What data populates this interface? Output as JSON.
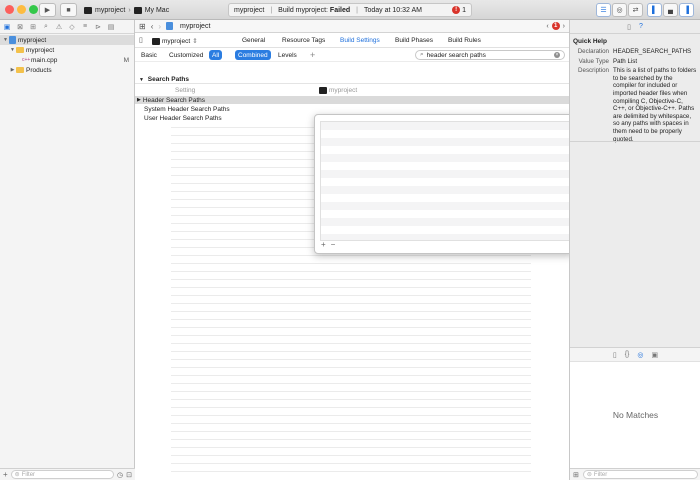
{
  "toolbar": {
    "scheme_project": "myproject",
    "scheme_destination": "My Mac",
    "status_project": "myproject",
    "status_sep": "|",
    "status_build_prefix": "Build myproject:",
    "status_build_result": "Failed",
    "status_sep2": "|",
    "status_time": "Today at 10:32 AM",
    "error_count": "1",
    "colors": {
      "close": "#fc605c",
      "minimize": "#fdbc40",
      "zoom": "#34c84a",
      "accent": "#1d6fdc",
      "error": "#d9342b"
    }
  },
  "navigator": {
    "tree": [
      {
        "label": "myproject",
        "icon": "project-icon"
      },
      {
        "label": "myproject",
        "icon": "folder-icon"
      },
      {
        "label": "main.cpp",
        "icon": "cpp-file-icon",
        "badge": "M"
      },
      {
        "label": "Products",
        "icon": "folder-icon"
      }
    ],
    "filter_placeholder": "Filter"
  },
  "editor": {
    "jump_project": "myproject",
    "error_count": "1",
    "target": "myproject",
    "tabs": [
      "General",
      "Resource Tags",
      "Build Settings",
      "Build Phases",
      "Build Rules"
    ],
    "filters": [
      "Basic",
      "Customized",
      "All",
      "Combined",
      "Levels"
    ],
    "add_label": "+",
    "search_value": "header search paths",
    "section_title": "Search Paths",
    "col_setting": "Setting",
    "col_target": "myproject",
    "settings": [
      "Header Search Paths",
      "System Header Search Paths",
      "User Header Search Paths"
    ],
    "popover_add": "+",
    "popover_remove": "−"
  },
  "inspector": {
    "title": "Quick Help",
    "declaration_label": "Declaration",
    "declaration_value": "HEADER_SEARCH_PATHS",
    "value_type_label": "Value Type",
    "value_type_value": "Path List",
    "description_label": "Description",
    "description_value": "This is a list of paths to folders to be searched by the compiler for included or imported header files when compiling C, Objective-C, C++, or Objective-C++. Paths are delimited by whitespace, so any paths with spaces in them need to be properly quoted.",
    "no_matches": "No Matches",
    "filter_placeholder": "Filter"
  }
}
